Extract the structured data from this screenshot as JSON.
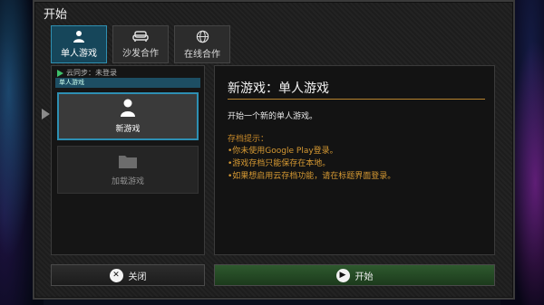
{
  "window": {
    "title": "开始"
  },
  "tabs": [
    {
      "label": "单人游戏",
      "icon": "person-icon",
      "active": true
    },
    {
      "label": "沙发合作",
      "icon": "sofa-icon",
      "active": false
    },
    {
      "label": "在线合作",
      "icon": "globe-icon",
      "active": false
    }
  ],
  "save_panel": {
    "sync_status": "云同步：未登录",
    "list_header": "单人游戏",
    "slots": [
      {
        "label": "新游戏",
        "icon": "person-icon"
      },
      {
        "label": "加载游戏",
        "icon": "folder-icon"
      }
    ]
  },
  "detail": {
    "title": "新游戏：单人游戏",
    "description": "开始一个新的单人游戏。",
    "tips_title": "存档提示：",
    "tips": [
      "•你未使用Google Play登录。",
      "•游戏存档只能保存在本地。",
      "•如果想启用云存档功能，请在标题界面登录。"
    ]
  },
  "actions": {
    "close_glyph": "✕",
    "close_label": "关闭",
    "start_glyph": "▶",
    "start_label": "开始"
  },
  "colors": {
    "tab_active": "#16465a",
    "selection_border": "#2d8fb3",
    "accent_rule": "#b8842e",
    "tip_text": "#d79a33",
    "start_button": "#2e5a2e"
  }
}
